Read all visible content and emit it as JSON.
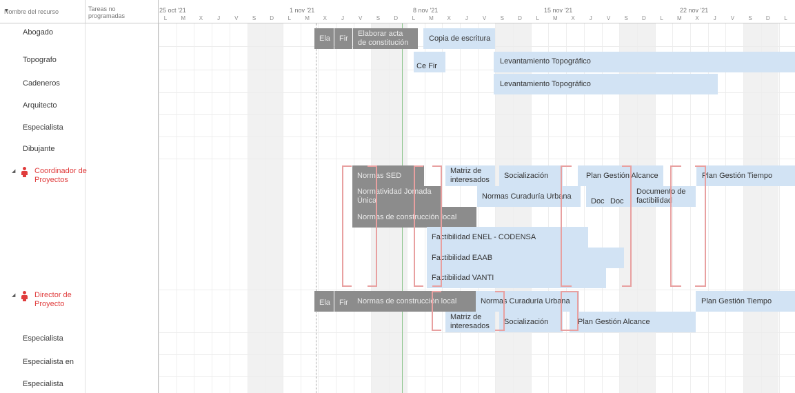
{
  "header": {
    "resource_name": "Nombre del recurso",
    "unscheduled_tasks": "Tareas no programadas",
    "sort_icon": "triangle-down-icon",
    "weeks": [
      "25 oct '21",
      "1 nov '21",
      "8 nov '21",
      "15 nov '21",
      "22 nov '21"
    ],
    "day_letters": [
      "L",
      "M",
      "X",
      "J",
      "V",
      "S",
      "D"
    ]
  },
  "resources": [
    {
      "name": "Abogado"
    },
    {
      "name": "Topografo"
    },
    {
      "name": "Cadeneros"
    },
    {
      "name": "Arquitecto"
    },
    {
      "name": "Especialista"
    },
    {
      "name": "Dibujante"
    },
    {
      "name": "Coordinador de Proyectos",
      "group": true,
      "icon": "person-icon"
    },
    {
      "name": "Director de Proyecto",
      "group": true,
      "icon": "person-icon"
    },
    {
      "name": "Especialista"
    },
    {
      "name": "Especialista en"
    },
    {
      "name": "Especialista"
    }
  ],
  "tasks": [
    {
      "label": "Ela",
      "color": "gray"
    },
    {
      "label": "Fir",
      "color": "gray"
    },
    {
      "label": "Elaborar acta de constitución",
      "color": "gray"
    },
    {
      "label": "Copia de escritura",
      "color": "blue"
    },
    {
      "label": "Ce",
      "color": "blue"
    },
    {
      "label": "Fir",
      "color": "blue"
    },
    {
      "label": "Levantamiento Topográfico",
      "color": "blue"
    },
    {
      "label": "Levantamiento Topográfico",
      "color": "blue"
    },
    {
      "label": "Normas SED",
      "color": "gray"
    },
    {
      "label": "Normatividad Jornada Única",
      "color": "gray"
    },
    {
      "label": "Normas de construcción local",
      "color": "gray"
    },
    {
      "label": "Matriz de interesados",
      "color": "blue"
    },
    {
      "label": "Socialización",
      "color": "blue"
    },
    {
      "label": "Plan Gestión Alcance",
      "color": "blue"
    },
    {
      "label": "Plan Gestión Tiempo",
      "color": "blue"
    },
    {
      "label": "Normas Curaduría Urbana",
      "color": "blue"
    },
    {
      "label": "Doc",
      "color": "blue"
    },
    {
      "label": "Doc",
      "color": "blue"
    },
    {
      "label": "Documento de factibilidad",
      "color": "blue"
    },
    {
      "label": "Factibilidad ENEL - CODENSA",
      "color": "blue"
    },
    {
      "label": "Factibilidad EAAB",
      "color": "blue"
    },
    {
      "label": "Factibilidad VANTI",
      "color": "blue"
    },
    {
      "label": "Ela",
      "color": "gray"
    },
    {
      "label": "Fir",
      "color": "gray"
    },
    {
      "label": "Normas de construcción local",
      "color": "gray"
    },
    {
      "label": "Normas Curaduría Urbana",
      "color": "blue"
    },
    {
      "label": "Plan Gestión Tiempo",
      "color": "blue"
    },
    {
      "label": "Matriz de interesados",
      "color": "blue"
    },
    {
      "label": "Socialización",
      "color": "blue"
    },
    {
      "label": "Plan Gestión Alcance",
      "color": "blue"
    }
  ],
  "colors": {
    "task_blue": "#d2e3f4",
    "task_gray": "#8c8c8c",
    "overallocated": "#e03c3c",
    "today_line": "#8cc58c"
  }
}
